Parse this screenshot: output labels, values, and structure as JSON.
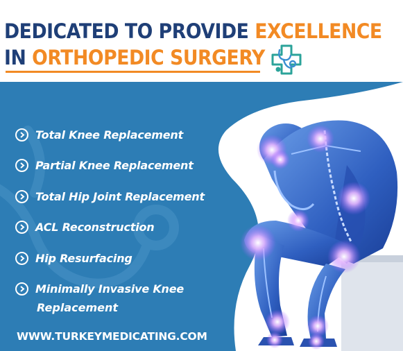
{
  "header": {
    "title_line1_dark": "DEDICATED TO PROVIDE",
    "title_line1_orange": "EXCELLENCE",
    "title_line2_dark": "IN",
    "title_line2_orange": "ORTHOPEDIC SURGERY",
    "logo_icon": "medical-cross-stethoscope-icon"
  },
  "procedures": {
    "items": [
      {
        "label": "Total Knee Replacement"
      },
      {
        "label": "Partial Knee Replacement"
      },
      {
        "label": "Total Hip Joint Replacement"
      },
      {
        "label": "ACL Reconstruction"
      },
      {
        "label": "Hip Resurfacing"
      },
      {
        "label": "Minimally Invasive Knee"
      }
    ],
    "continuation": "Replacement",
    "bullet_icon": "chevron-right-circle-icon"
  },
  "footer": {
    "website": "WWW.TURKEYMEDICATING.COM"
  },
  "colors": {
    "navy": "#1f3f77",
    "orange": "#f28a24",
    "panel_blue": "#2d7db5",
    "figure_blue": "#3a6fc9",
    "glow": "#e6b6ff"
  }
}
